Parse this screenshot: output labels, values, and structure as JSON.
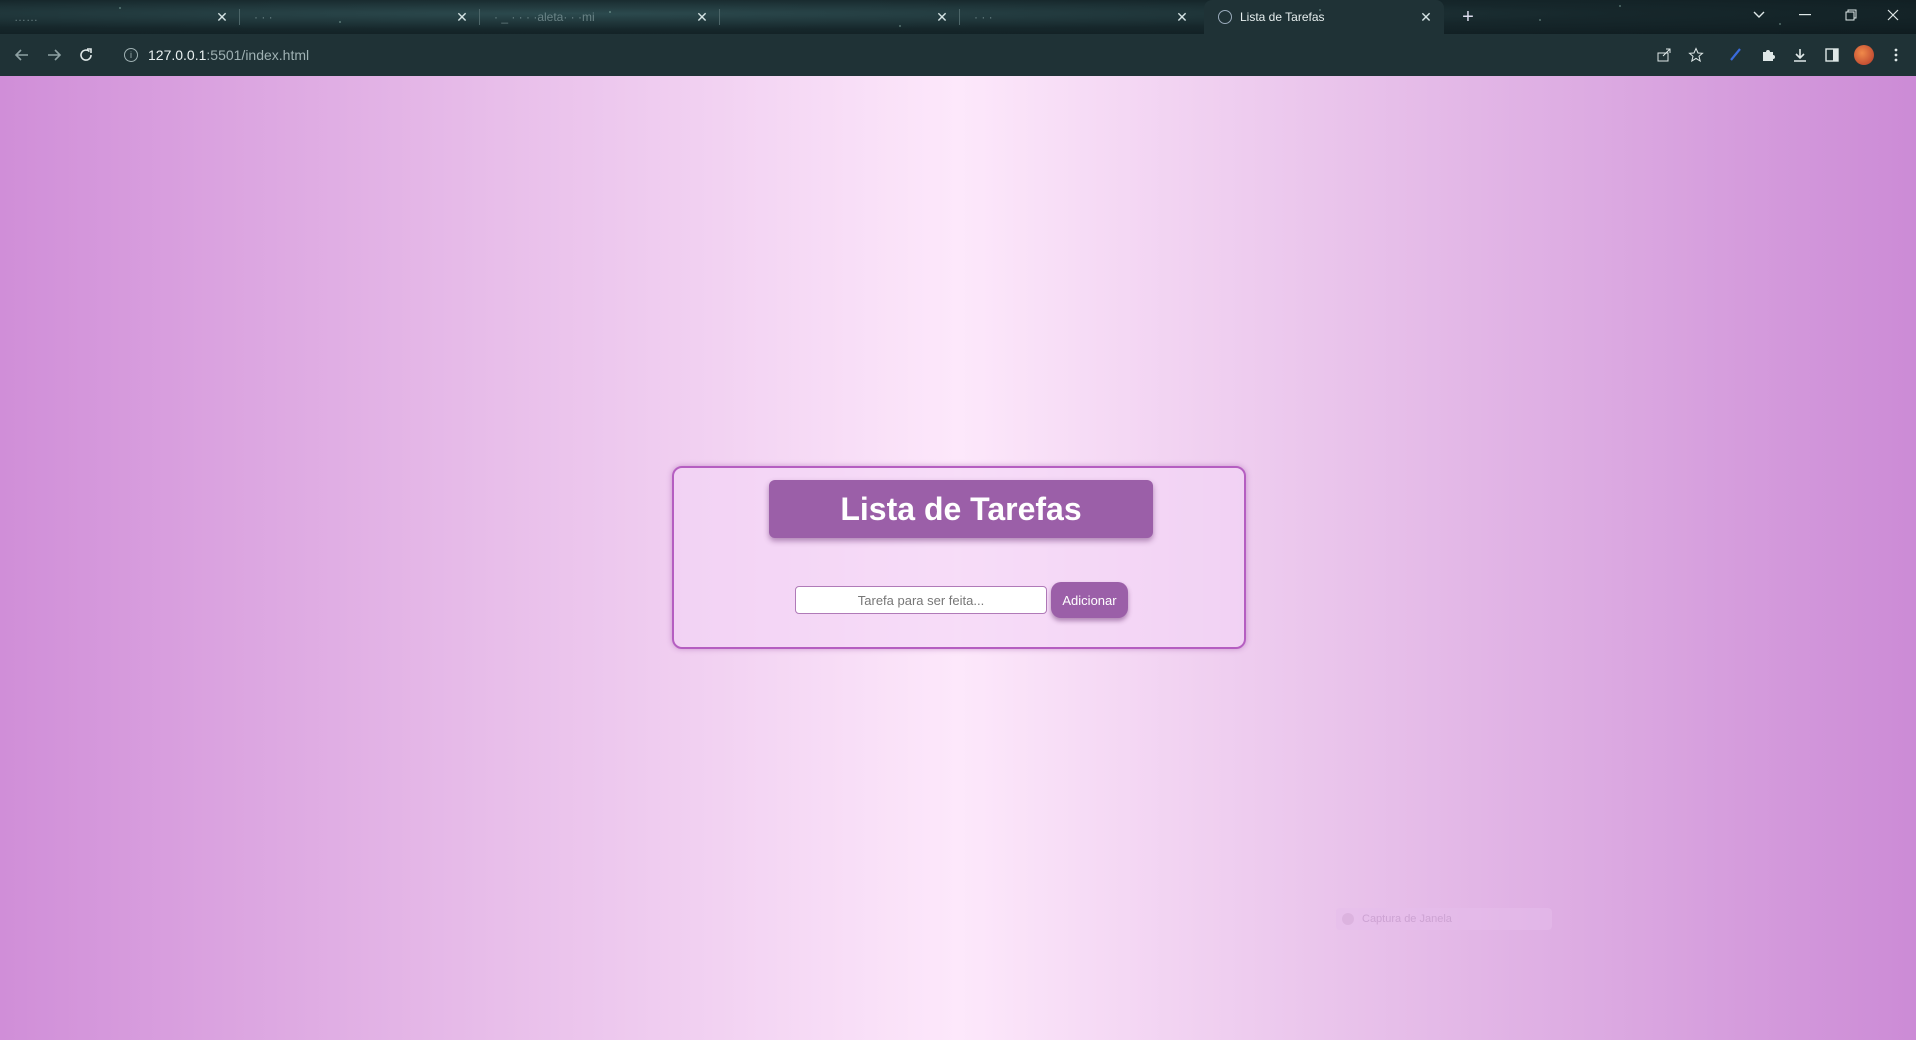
{
  "browser": {
    "tabs": [
      {
        "title": "……",
        "active": false
      },
      {
        "title": "· · ·",
        "active": false
      },
      {
        "title": "· _ · · · ·aleta· · ·mi",
        "active": false
      },
      {
        "title": "",
        "active": false
      },
      {
        "title": "· · ·",
        "active": false
      },
      {
        "title": "Lista de Tarefas",
        "active": true
      }
    ],
    "new_tab_glyph": "+",
    "close_glyph": "✕",
    "address": {
      "host": "127.0.0.1",
      "path": ":5501/index.html"
    },
    "toolbar_icons": [
      "share-icon",
      "star-icon",
      "pen-icon",
      "extensions-icon",
      "download-icon",
      "sidebar-icon",
      "profile-avatar",
      "menu-icon"
    ],
    "window_controls": [
      "chevron-down-icon",
      "minimize-icon",
      "restore-icon",
      "close-icon"
    ]
  },
  "app": {
    "title": "Lista de Tarefas",
    "input": {
      "placeholder": "Tarefa para ser feita...",
      "value": ""
    },
    "add_button_label": "Adicionar"
  },
  "overlay": {
    "toast_label": "Captura de Janela"
  },
  "colors": {
    "accent": "#9b5fa8",
    "card_border": "#b55ec1",
    "page_edge": "#d08ed8",
    "page_center": "#fde8fb"
  }
}
